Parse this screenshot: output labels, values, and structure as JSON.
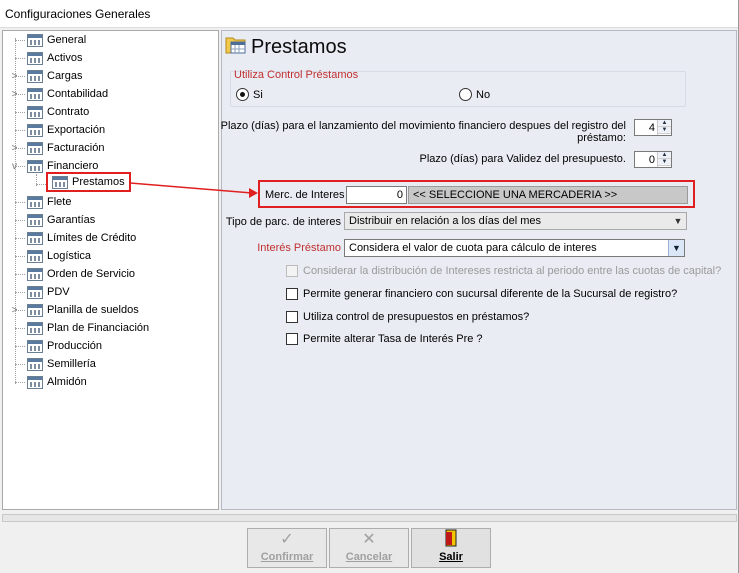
{
  "window": {
    "title": "Configuraciones Generales"
  },
  "tree": {
    "items": [
      {
        "label": "General",
        "expander": ""
      },
      {
        "label": "Activos",
        "expander": ""
      },
      {
        "label": "Cargas",
        "expander": ">"
      },
      {
        "label": "Contabilidad",
        "expander": ">"
      },
      {
        "label": "Contrato",
        "expander": ""
      },
      {
        "label": "Exportación",
        "expander": ""
      },
      {
        "label": "Facturación",
        "expander": ">"
      },
      {
        "label": "Financiero",
        "expander": "v"
      },
      {
        "label": "Prestamos",
        "expander": "",
        "child": true,
        "selected": true
      },
      {
        "label": "Flete",
        "expander": ""
      },
      {
        "label": "Garantías",
        "expander": ""
      },
      {
        "label": "Límites de Crédito",
        "expander": ""
      },
      {
        "label": "Logística",
        "expander": ""
      },
      {
        "label": "Orden de Servicio",
        "expander": ""
      },
      {
        "label": "PDV",
        "expander": ""
      },
      {
        "label": "Planilla de sueldos",
        "expander": ">"
      },
      {
        "label": "Plan de Financiación",
        "expander": ""
      },
      {
        "label": "Producción",
        "expander": ""
      },
      {
        "label": "Semillería",
        "expander": ""
      },
      {
        "label": "Almidón",
        "expander": ""
      }
    ]
  },
  "content": {
    "title": "Prestamos",
    "control_group": {
      "title": "Utiliza Control Préstamos",
      "option_si": "Si",
      "option_no": "No",
      "selected": "Si"
    },
    "plazo_lanzamiento": {
      "label_line1": "Plazo (días) para el lanzamiento del movimiento financiero despues del registro del",
      "label_line2": "préstamo:",
      "value": "4"
    },
    "plazo_validez": {
      "label": "Plazo (días) para Validez del presupuesto.",
      "value": "0"
    },
    "mercaderia": {
      "label": "Merc. de Interes",
      "code": "0",
      "description": "<< SELECCIONE UNA MERCADERIA >>"
    },
    "tipo_parcela": {
      "label": "Tipo de parc. de interes",
      "value": "Distribuir en relación a los días del mes"
    },
    "interes_prestamo": {
      "label": "Interés Préstamo",
      "value": "Considera el valor de cuota para cálculo de interes"
    },
    "checkboxes": [
      {
        "label": "Considerar la distribución de Intereses restricta al periodo entre las cuotas de capital?",
        "disabled": true
      },
      {
        "label": "Permite generar financiero con sucursal diferente de la Sucursal de registro?",
        "disabled": false
      },
      {
        "label": "Utiliza control de presupuestos en préstamos?",
        "disabled": false
      },
      {
        "label": "Permite alterar Tasa de Interés Pre ?",
        "disabled": false
      }
    ]
  },
  "footer": {
    "confirm_label": "Confirmar",
    "cancel_label": "Cancelar",
    "exit_label": "Salir"
  },
  "colors": {
    "highlight": "#e02020",
    "panel": "#e9ecf3",
    "required_label": "#c03030"
  }
}
